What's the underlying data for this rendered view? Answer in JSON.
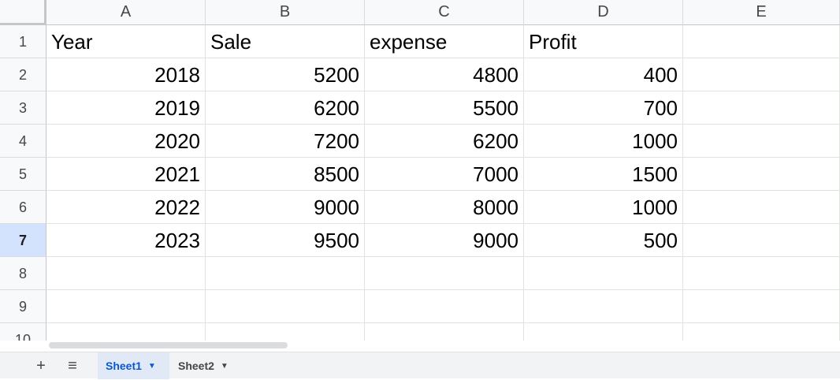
{
  "columns": [
    "A",
    "B",
    "C",
    "D",
    "E"
  ],
  "rows": [
    "1",
    "2",
    "3",
    "4",
    "5",
    "6",
    "7",
    "8",
    "9",
    "10"
  ],
  "selected_row": "7",
  "cells": [
    [
      "Year",
      "Sale",
      "expense",
      "Profit",
      ""
    ],
    [
      "2018",
      "5200",
      "4800",
      "400",
      ""
    ],
    [
      "2019",
      "6200",
      "5500",
      "700",
      ""
    ],
    [
      "2020",
      "7200",
      "6200",
      "1000",
      ""
    ],
    [
      "2021",
      "8500",
      "7000",
      "1500",
      ""
    ],
    [
      "2022",
      "9000",
      "8000",
      "1000",
      ""
    ],
    [
      "2023",
      "9500",
      "9000",
      "500",
      ""
    ],
    [
      "",
      "",
      "",
      "",
      ""
    ],
    [
      "",
      "",
      "",
      "",
      ""
    ],
    [
      "",
      "",
      "",
      "",
      ""
    ]
  ],
  "footer": {
    "add_sheet_symbol": "+",
    "all_sheets_symbol": "≡",
    "tabs": [
      {
        "label": "Sheet1",
        "active": true
      },
      {
        "label": "Sheet2",
        "active": false
      }
    ]
  },
  "colors": {
    "accent": "#0b57d0",
    "selected_row_bg": "#d3e3fd"
  }
}
